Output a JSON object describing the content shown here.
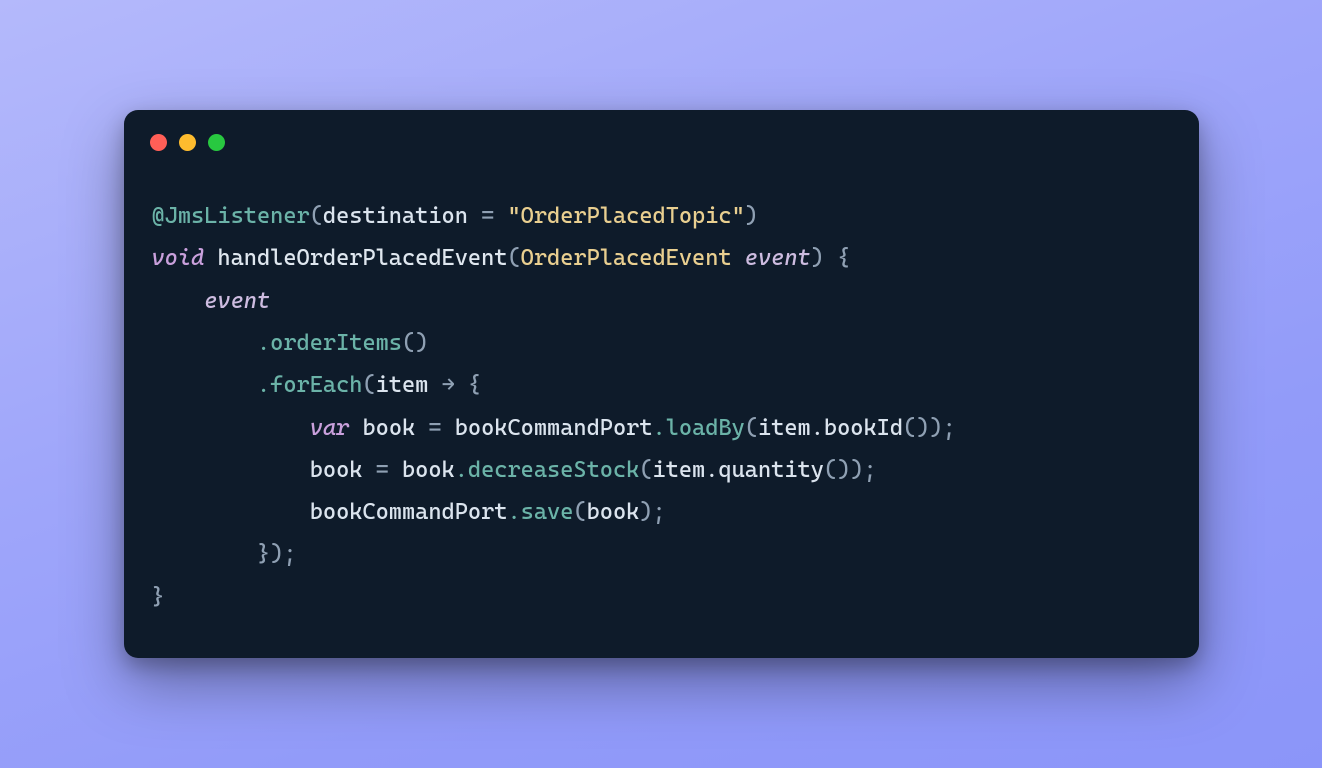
{
  "code": {
    "annotation": "@JmsListener",
    "dest_key": "destination",
    "eq": " = ",
    "dest_val": "\"OrderPlacedTopic\"",
    "void": "void",
    "method": "handleOrderPlacedEvent",
    "param_type": "OrderPlacedEvent",
    "param_name": "event",
    "event_ref": "event",
    "orderItems": ".orderItems",
    "forEach": ".forEach",
    "item": "item",
    "arrow": " → ",
    "var": "var",
    "book": "book",
    "assign1_rhs_obj": "bookCommandPort",
    "loadBy": ".loadBy",
    "item_bookId": "item.bookId",
    "book2": "book",
    "book_rhs": "book",
    "decreaseStock": ".decreaseStock",
    "item_quantity": "item.quantity",
    "save_obj": "bookCommandPort",
    "save": ".save",
    "save_arg": "book",
    "p_open": "(",
    "p_close": ")",
    "brace_open": "{",
    "brace_close": "}",
    "semi": ";",
    "close_paren_semi": ");",
    "empty_parens": "()"
  }
}
